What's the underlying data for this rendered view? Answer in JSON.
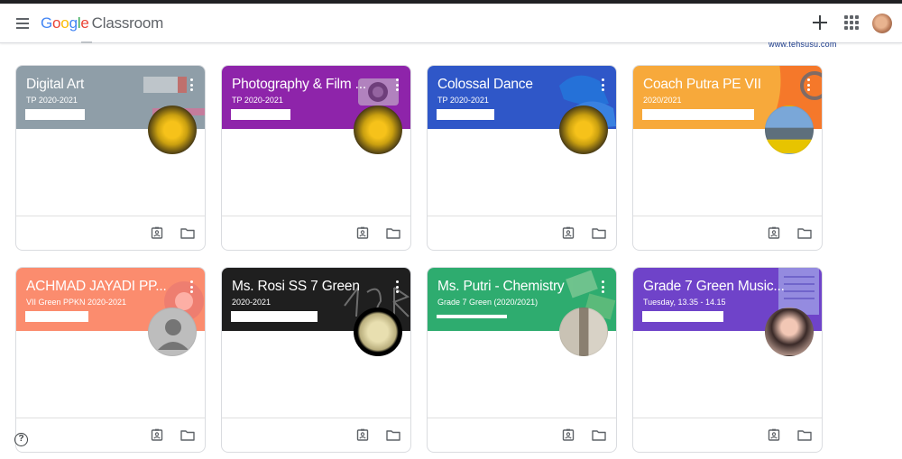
{
  "app": {
    "logo_parts": [
      "G",
      "o",
      "o",
      "g",
      "l",
      "e"
    ],
    "logo_product": "Classroom",
    "watermark": "www.tehsusu.com",
    "help_glyph": "?"
  },
  "icons": {
    "menu": "hamburger-icon",
    "create": "plus-icon",
    "apps": "apps-grid-icon",
    "portfolio": "assignment-ind-icon",
    "folder": "folder-icon",
    "help": "help-icon"
  },
  "colors": {
    "gray": "#8f9ea8",
    "purple": "#8e24aa",
    "blue": "#2f57c8",
    "orange": "#f7a93b",
    "coral": "#fb8c6e",
    "black": "#1f1f1f",
    "green": "#2eac6f",
    "violet": "#6f43c9"
  },
  "classes": [
    {
      "title": "Digital Art",
      "section": "TP 2020-2021"
    },
    {
      "title": "Photography & Film ...",
      "section": "TP 2020-2021"
    },
    {
      "title": "Colossal Dance",
      "section": "TP 2020-2021"
    },
    {
      "title": "Coach Putra PE VII",
      "section": "2020/2021"
    },
    {
      "title": "ACHMAD JAYADI PP...",
      "section": "VII Green PPKN 2020-2021"
    },
    {
      "title": "Ms. Rosi SS 7 Green",
      "section": "2020-2021"
    },
    {
      "title": "Ms. Putri - Chemistry",
      "section": "Grade 7 Green (2020/2021)"
    },
    {
      "title": "Grade 7 Green Music...",
      "section": "Tuesday, 13.35 - 14.15"
    }
  ]
}
